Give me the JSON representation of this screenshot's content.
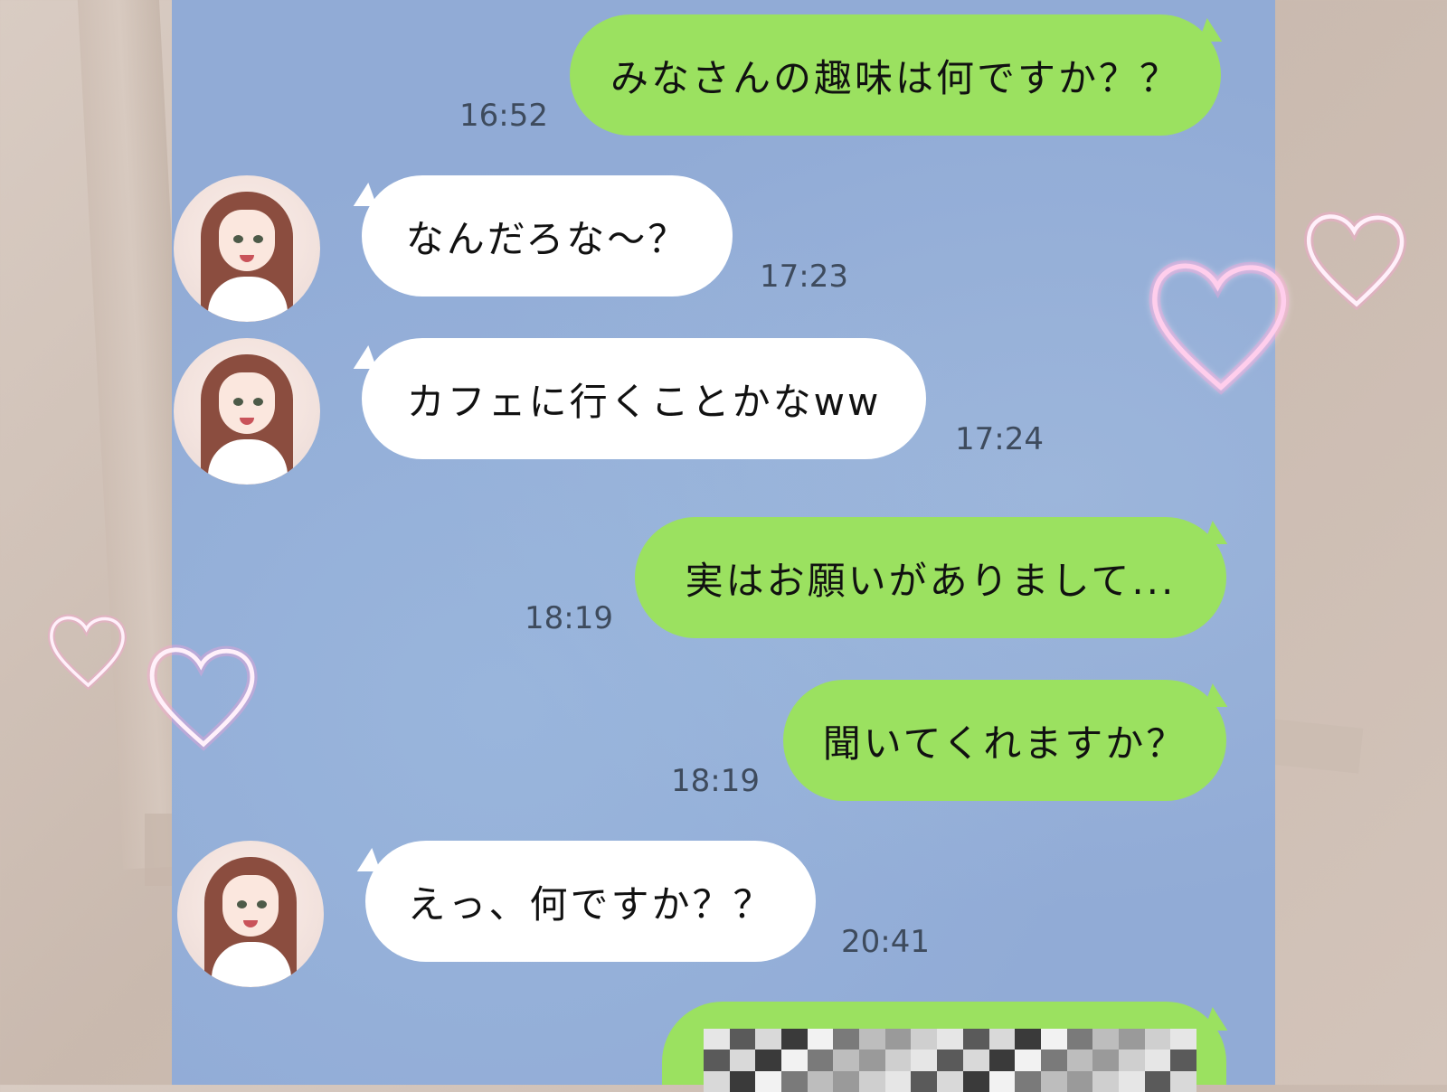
{
  "messages": [
    {
      "side": "out",
      "text": "みなさんの趣味は何ですか？？",
      "time": "16:52"
    },
    {
      "side": "in",
      "text": "なんだろな～？",
      "time": "17:23"
    },
    {
      "side": "in",
      "text": "カフェに行くことかなww",
      "time": "17:24"
    },
    {
      "side": "out",
      "text": "実はお願いがありまして...",
      "time": "18:19"
    },
    {
      "side": "out",
      "text": "聞いてくれますか？",
      "time": "18:19"
    },
    {
      "side": "in",
      "text": "えっ、何ですか？？",
      "time": "20:41"
    }
  ],
  "colors": {
    "chat_background": "#91abd6",
    "outgoing_bubble": "#9be160",
    "incoming_bubble": "#ffffff",
    "heart_glow": "#ff9fd8",
    "timestamp": "#3e4b5d"
  },
  "icons": {
    "avatar": "avatar-icon",
    "heart": "heart-icon",
    "mosaic": "censored-mosaic"
  }
}
